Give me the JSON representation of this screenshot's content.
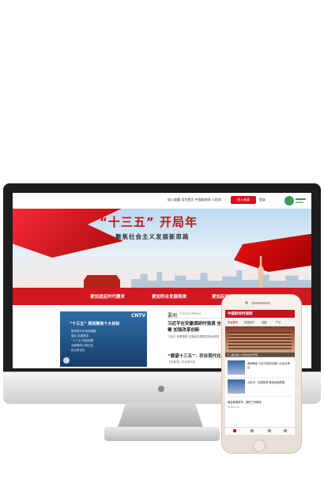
{
  "site": {
    "top_links": "加入收藏 设为首页 中国政府网 人民网",
    "top_button": "进入新版",
    "login": "登录"
  },
  "banner": {
    "title": "“十三五”  开局年",
    "subtitle": "聚焦社会主义发展新思路"
  },
  "nav": {
    "items": [
      "更加适应时代要求",
      "更加符合发展规律",
      "更加反映"
    ]
  },
  "video": {
    "logo": "CNTV",
    "heading": "“十三五” 规划聚焦十大目标",
    "lines": "国务院今年规划纲要\n建议 发展理念\n“十三五”规划纲要\n全面建成小康社会\n民生新目标"
  },
  "news": {
    "section": "要闻",
    "section_en": "Focus News",
    "headline": "习近平在安徽调研时强调 全面规划部署 加强改革创新",
    "summary": "习近平 考察调研 实施新发展理念推动改革",
    "headline2": "“展望十三五”：农业现代化",
    "summary2": "【关键词】农业现代化"
  },
  "phone": {
    "title": "中国财经时报网",
    "tabs": [
      "财经要闻",
      "宏观经济",
      "金融",
      "产业"
    ],
    "hero_caption": "十二届全国人大四次会议开幕",
    "items": [
      {
        "text": "各地两会 习近平参加全国人大会议审议"
      },
      {
        "text": "习近平：加快改革 推进全面发展"
      }
    ],
    "list": [
      {
        "title": "两会新闻发布：政府工作报告",
        "sub": "2016-03-05"
      }
    ],
    "footer_icons": [
      "home-icon",
      "news-icon",
      "video-icon",
      "user-icon"
    ]
  }
}
